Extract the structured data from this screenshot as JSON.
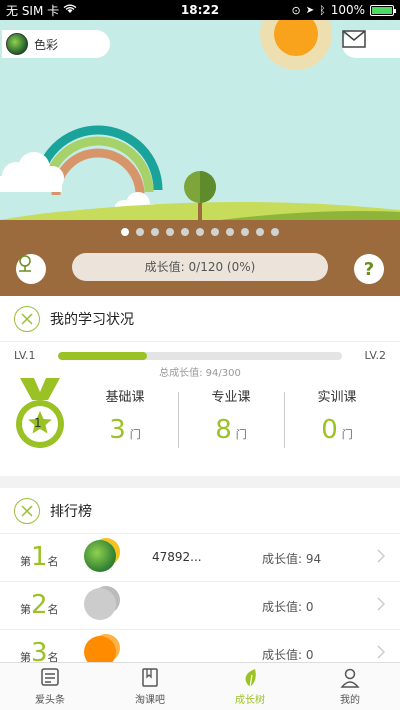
{
  "status_bar": {
    "carrier": "无 SIM 卡",
    "time": "18:22",
    "battery": "100%"
  },
  "header": {
    "username": "色彩"
  },
  "scene": {
    "page_count": 11,
    "active_page": 0
  },
  "growth": {
    "label": "成长值: 0/120 (0%)"
  },
  "study": {
    "title": "我的学习状况",
    "level_left": "LV.1",
    "level_right": "LV.2",
    "progress_fraction": 0.3133,
    "total_label": "总成长值: 94/300",
    "medal_level": "1",
    "courses": [
      {
        "label": "基础课",
        "value": "3",
        "unit": "门"
      },
      {
        "label": "专业课",
        "value": "8",
        "unit": "门"
      },
      {
        "label": "实训课",
        "value": "0",
        "unit": "门"
      }
    ]
  },
  "ranking": {
    "title": "排行榜",
    "prefix": "第",
    "suffix": "名",
    "rows": [
      {
        "place": "1",
        "name": "47892...",
        "score": "成长值: 94",
        "color": "#2e7d32"
      },
      {
        "place": "2",
        "name": "",
        "score": "成长值: 0",
        "color": "#cccccc"
      },
      {
        "place": "3",
        "name": "",
        "score": "成长值: 0",
        "color": "#ff8c00"
      }
    ]
  },
  "tabs": [
    {
      "label": "爱头条",
      "icon": "news-icon",
      "active": false
    },
    {
      "label": "淘课吧",
      "icon": "book-icon",
      "active": false
    },
    {
      "label": "成长树",
      "icon": "leaf-icon",
      "active": true
    },
    {
      "label": "我的",
      "icon": "user-icon",
      "active": false
    }
  ],
  "colors": {
    "accent": "#9bc225",
    "sky": "#c6ece8",
    "soil": "#9b6b3e"
  }
}
